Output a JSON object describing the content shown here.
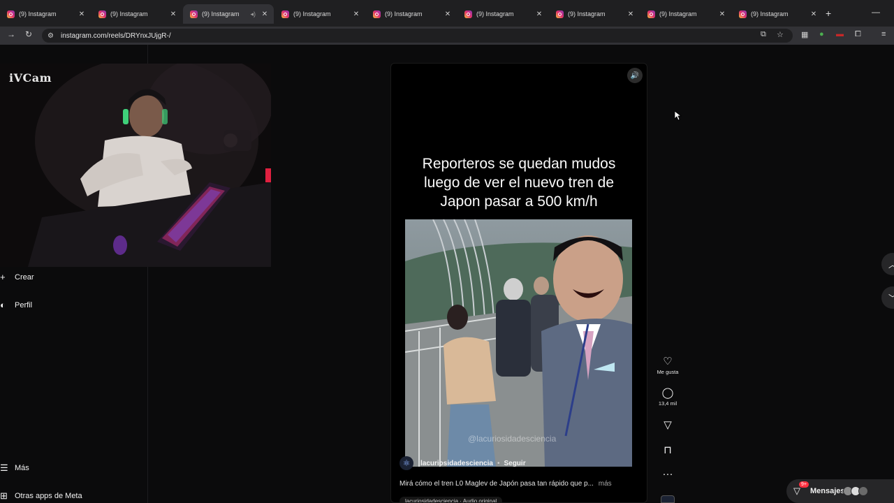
{
  "browser": {
    "tabs": [
      {
        "title": "(9) Instagram",
        "active": false
      },
      {
        "title": "(9) Instagram",
        "active": false
      },
      {
        "title": "(9) Instagram",
        "active": true
      },
      {
        "title": "(9) Instagram",
        "active": false
      },
      {
        "title": "(9) Instagram",
        "active": false
      },
      {
        "title": "(9) Instagram",
        "active": false
      },
      {
        "title": "(9) Instagram",
        "active": false
      },
      {
        "title": "(9) Instagram",
        "active": false
      },
      {
        "title": "(9) Instagram",
        "active": false
      }
    ],
    "close_glyph": "✕",
    "new_tab_glyph": "+",
    "minimize_glyph": "—",
    "url": "instagram.com/reels/DRYnxJUjgR-/"
  },
  "webcam": {
    "label": "iVCam"
  },
  "sidebar": {
    "items": [
      {
        "label": "Crear",
        "icon": "plus-icon"
      },
      {
        "label": "Perfil",
        "icon": "profile-icon"
      },
      {
        "label": "Más",
        "icon": "menu-icon"
      },
      {
        "label": "Otras apps de Meta",
        "icon": "apps-icon"
      }
    ]
  },
  "reel": {
    "heading_lines": [
      "Reporteros se quedan mudos",
      "luego de ver el nuevo tren de",
      "Japon pasar a 500 km/h"
    ],
    "watermark": "@lacuriosidadesciencia",
    "author": "lacuriosidadesciencia",
    "dot": "•",
    "follow_label": "Seguir",
    "caption": "Mirá cómo el tren L0 Maglev de Japón pasa tan rápido que p...",
    "more_label": "más",
    "audio": "lacuriosidadesciencia · Audio original"
  },
  "actions": {
    "like_label": "Me gusta",
    "comments_count": "13,4 mil"
  },
  "messages": {
    "label": "Mensajes",
    "badge": "9+"
  },
  "colors": {
    "background": "#0b0b0c",
    "chrome_dark": "#1f1f21",
    "chrome_light": "#323236",
    "badge_red": "#ff3040"
  }
}
